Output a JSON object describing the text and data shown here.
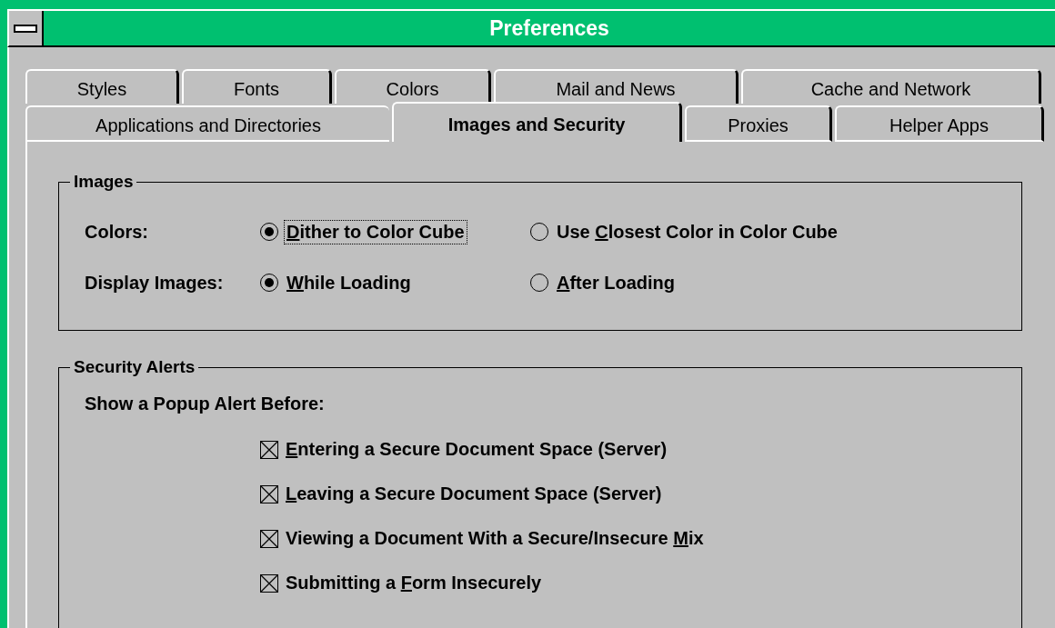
{
  "window": {
    "title": "Preferences"
  },
  "tab_rows": [
    [
      {
        "label": "Styles",
        "selected": false
      },
      {
        "label": "Fonts",
        "selected": false
      },
      {
        "label": "Colors",
        "selected": false
      },
      {
        "label": "Mail and News",
        "selected": false
      },
      {
        "label": "Cache and Network",
        "selected": false
      }
    ],
    [
      {
        "label": "Applications and Directories",
        "selected": false
      },
      {
        "label": "Images and Security",
        "selected": true
      },
      {
        "label": "Proxies",
        "selected": false
      },
      {
        "label": "Helper Apps",
        "selected": false
      }
    ]
  ],
  "images_group": {
    "title": "Images",
    "rows": [
      {
        "label": "Colors:",
        "options": [
          {
            "label": {
              "key": "D",
              "after": "ither to Color Cube"
            },
            "selected": true,
            "focused": true
          },
          {
            "label": {
              "before": "Use ",
              "key": "C",
              "after": "losest Color in Color Cube"
            },
            "selected": false,
            "focused": false
          }
        ]
      },
      {
        "label": "Display Images:",
        "options": [
          {
            "label": {
              "key": "W",
              "after": "hile Loading"
            },
            "selected": true,
            "focused": false
          },
          {
            "label": {
              "key": "A",
              "after": "fter Loading"
            },
            "selected": false,
            "focused": false
          }
        ]
      }
    ]
  },
  "security_group": {
    "title": "Security Alerts",
    "prompt": "Show a Popup Alert Before:",
    "alerts": [
      {
        "label": {
          "key": "E",
          "after": "ntering a Secure Document Space (Server)"
        },
        "checked": true
      },
      {
        "label": {
          "key": "L",
          "after": "eaving a Secure Document Space (Server)"
        },
        "checked": true
      },
      {
        "label": {
          "before": "Viewing a Document With a Secure/Insecure ",
          "key": "M",
          "after": "ix"
        },
        "checked": true
      },
      {
        "label": {
          "before": "Submitting a ",
          "key": "F",
          "after": "orm Insecurely"
        },
        "checked": true
      }
    ]
  }
}
